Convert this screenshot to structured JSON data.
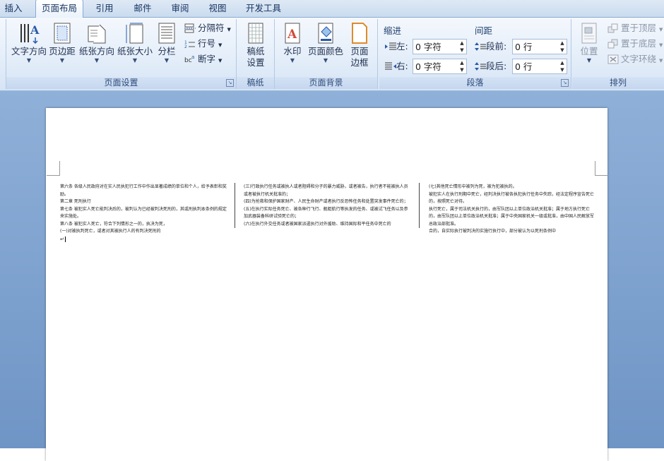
{
  "tabs": [
    "插入",
    "页面布局",
    "引用",
    "邮件",
    "审阅",
    "视图",
    "开发工具"
  ],
  "active_tab": "页面布局",
  "groups": {
    "page_setup": {
      "label": "页面设置",
      "text_direction": "文字方向",
      "margins": "页边距",
      "orientation": "纸张方向",
      "size": "纸张大小",
      "columns": "分栏",
      "breaks": "分隔符",
      "line_numbers": "行号",
      "hyphenation": "断字"
    },
    "manuscript": {
      "label": "稿纸",
      "settings_line1": "稿纸",
      "settings_line2": "设置"
    },
    "page_background": {
      "label": "页面背景",
      "watermark": "水印",
      "page_color": "页面颜色",
      "page_borders_line1": "页面",
      "page_borders_line2": "边框"
    },
    "paragraph": {
      "label": "段落",
      "indent_header": "缩进",
      "spacing_header": "间距",
      "left_label": "左:",
      "right_label": "右:",
      "before_label": "段前:",
      "after_label": "段后:",
      "left_value": "0 字符",
      "right_value": "0 字符",
      "before_value": "0 行",
      "after_value": "0 行"
    },
    "arrange": {
      "label": "排列",
      "position": "位置",
      "bring_front": "置于顶层",
      "send_back": "置于底层",
      "text_wrap": "文字环绕"
    }
  },
  "document": {
    "col1": [
      "第六条  各级人民政府对在实人民执犯行工作中作出显著成绩的单位和个人，给予表彰和奖励。",
      "    第二章  死刑执行",
      "    第七条  被犯实人死亡能判决后的，被判认为已经被判决死刑的，其或刑执判本条例的规定来实施处。",
      "    第八条  被犯实人死亡，符合下列情形之一的，执决为死，",
      "    (一)对被执判死亡，或者对其被执行人的有判决死刑的"
    ],
    "col2": [
      "    (三)行政执行任务或被执人或者阻碍和分子的暴力威胁，或者被告，执行者不能被执人员或者被执行机关批准的；",
      "    (四)为抢救和保护国家财产、人民生命财产或者执行反恐怖任务和处置突发事件死亡的；",
      "    (五)在执行实际任务死亡、被各种行飞行、舰艇航行等执发的任务、或被试飞任务以及参加武器装备科研试验死亡的；",
      "    (六)在执行外交任务或者被国家派遣执行对外援助、维持国际和平任务中死亡的"
    ],
    "col3": [
      "    (七)其他死亡情形中被列为死，被为犯被执的。",
      "    被犯实人在执行刑期中死亡，经判决执行被各执犯执行任务中失踪，经法定程序宣告死亡的，按照死亡对待。",
      "    执行死亡，属于司法机关执行的，由军队团以上单位政治机关批准；属于地方执行死亡的，由军队团以上单位政治机关批准；属于中央国家机关一级或批准，由中国人民解放军总政治部批准。",
      "    合的，自实际执行被判决的实施行执行中，部分被认为以死刑条例中"
    ]
  }
}
